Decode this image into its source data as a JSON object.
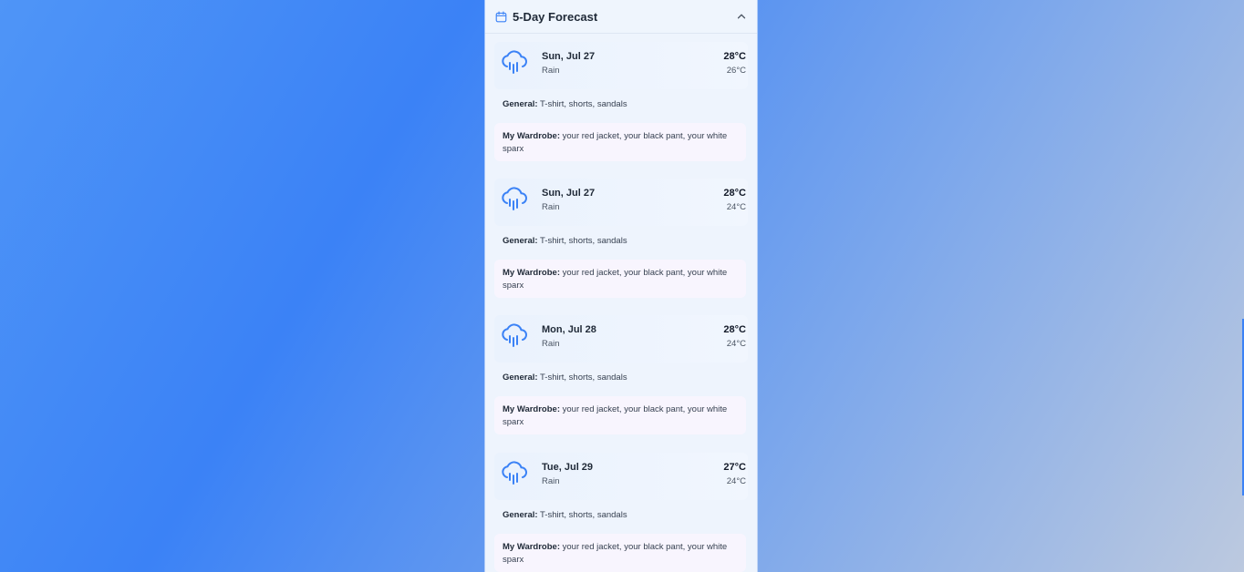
{
  "forecast": {
    "title": "5-Day Forecast",
    "days": [
      {
        "date": "Sun, Jul 27",
        "condition": "Rain",
        "high": "28°C",
        "low": "26°C",
        "general_label": "General:",
        "general_text": "T-shirt, shorts, sandals",
        "wardrobe_label": "My Wardrobe:",
        "wardrobe_text": "your red jacket, your black pant, your white sparx"
      },
      {
        "date": "Sun, Jul 27",
        "condition": "Rain",
        "high": "28°C",
        "low": "24°C",
        "general_label": "General:",
        "general_text": "T-shirt, shorts, sandals",
        "wardrobe_label": "My Wardrobe:",
        "wardrobe_text": "your red jacket, your black pant, your white sparx"
      },
      {
        "date": "Mon, Jul 28",
        "condition": "Rain",
        "high": "28°C",
        "low": "24°C",
        "general_label": "General:",
        "general_text": "T-shirt, shorts, sandals",
        "wardrobe_label": "My Wardrobe:",
        "wardrobe_text": "your red jacket, your black pant, your white sparx"
      },
      {
        "date": "Tue, Jul 29",
        "condition": "Rain",
        "high": "27°C",
        "low": "24°C",
        "general_label": "General:",
        "general_text": "T-shirt, shorts, sandals",
        "wardrobe_label": "My Wardrobe:",
        "wardrobe_text": "your red jacket, your black pant, your white sparx"
      }
    ]
  },
  "icons": {
    "header": "calendar-icon",
    "collapse": "chevron-up-icon",
    "weather": "rain-cloud-icon"
  },
  "colors": {
    "accent": "#3b82f6"
  }
}
